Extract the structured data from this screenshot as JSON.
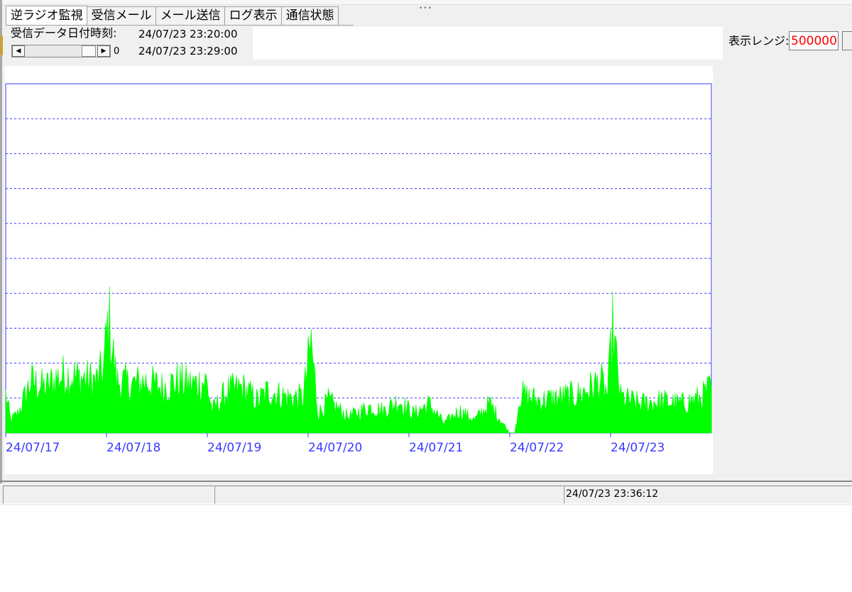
{
  "tabs": [
    "逆ラジオ監視",
    "受信メール",
    "メール送信",
    "ログ表示",
    "通信状態"
  ],
  "active_tab": 0,
  "header": {
    "received_datetime_label": "受信データ日付時刻:",
    "start_datetime": "24/07/23 23:20:00",
    "end_datetime": "24/07/23 23:29:00",
    "scroll_value": "0"
  },
  "range": {
    "label": "表示レンジ:",
    "value": "500000"
  },
  "icons": {
    "scroll_left": "arrow-left-icon",
    "scroll_right": "arrow-right-icon"
  },
  "colors": {
    "plot_fill": "#00ff00",
    "axis": "#3a3aff",
    "label": "#3a3aff",
    "range_value": "#ff0000"
  },
  "chart_data": {
    "type": "area",
    "title": "",
    "xlabel": "",
    "ylabel": "",
    "x_tick_labels": [
      "24/07/17",
      "24/07/18",
      "24/07/19",
      "24/07/20",
      "24/07/21",
      "24/07/22",
      "24/07/23"
    ],
    "x_range_days": [
      0,
      7
    ],
    "ylim": [
      0,
      500000
    ],
    "y_gridlines": 9,
    "grid": true,
    "series": [
      {
        "x_days": [
          0,
          0.05,
          0.12,
          0.25,
          0.4,
          0.5,
          0.6,
          0.75,
          0.9,
          0.97,
          1.02,
          1.1,
          1.25,
          1.4,
          1.55,
          1.7,
          1.85,
          1.99,
          2.05,
          2.2,
          2.35,
          2.5,
          2.6,
          2.8,
          2.95,
          3.03,
          3.1,
          3.2,
          3.4,
          3.6,
          3.75,
          3.9,
          4.05,
          4.2,
          4.35,
          4.5,
          4.65,
          4.8,
          5.0,
          5.05,
          5.1,
          5.2,
          5.3,
          5.5,
          5.7,
          5.9,
          5.97,
          6.02,
          6.1,
          6.3,
          6.5,
          6.7,
          6.9,
          6.99
        ],
        "values": [
          60000,
          20000,
          30000,
          80000,
          70000,
          85000,
          90000,
          85000,
          80000,
          100000,
          180000,
          80000,
          75000,
          80000,
          70000,
          80000,
          75000,
          80000,
          35000,
          65000,
          70000,
          50000,
          65000,
          55000,
          55000,
          140000,
          30000,
          50000,
          25000,
          40000,
          35000,
          50000,
          30000,
          45000,
          15000,
          35000,
          20000,
          45000,
          0,
          0,
          60000,
          55000,
          50000,
          55000,
          60000,
          80000,
          60000,
          160000,
          55000,
          45000,
          50000,
          45000,
          55000,
          70000
        ]
      }
    ]
  },
  "status": {
    "datetime": "24/07/23 23:36:12"
  }
}
